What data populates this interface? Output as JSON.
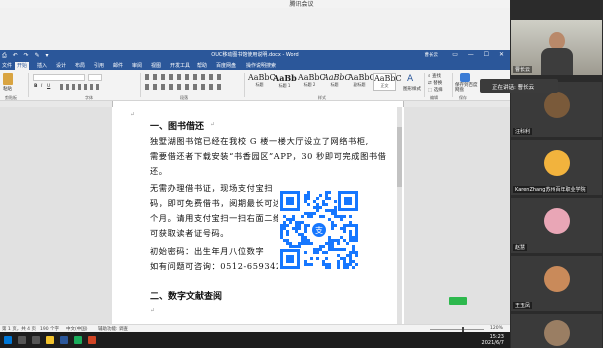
{
  "meeting": {
    "window_title": "腾讯会议",
    "speaking_label": "正在讲话: 曹长云"
  },
  "word": {
    "doc_title": "OUC移动图书馆使用说明.docx - Word",
    "user": "曹长云",
    "qat": "⎙ ↶ ↷ ✎ ▾",
    "window_controls": "▭ — ☐ ✕",
    "tabs": [
      "文件",
      "开始",
      "插入",
      "设计",
      "布局",
      "引用",
      "邮件",
      "审阅",
      "视图",
      "开发工具",
      "帮助",
      "百度网盘",
      "操作说明搜索"
    ],
    "active_tab": "开始",
    "ribbon": {
      "paste": "粘贴",
      "clipboard_label": "剪贴板",
      "font_label": "字体",
      "paragraph_label": "段落",
      "styles_label": "样式",
      "edit_label": "编辑",
      "save_label": "保存",
      "find": "查找",
      "replace": "替换",
      "select": "选择",
      "text_style_btn": "图形样式",
      "save_to_baidu": "保存到百度网盘",
      "styles": [
        {
          "sample": "AaBbC",
          "name": "标题"
        },
        {
          "sample": "AaBb",
          "name": "标题 1"
        },
        {
          "sample": "AaBbC",
          "name": "标题 2"
        },
        {
          "sample": "AaBbC",
          "name": "标题"
        },
        {
          "sample": "AaBbC",
          "name": "副标题"
        },
        {
          "sample": "AaBbC",
          "name": "正文"
        }
      ]
    },
    "document": {
      "heading1": "一、图书借还",
      "para1_line1": "独墅湖图书馆已经在我校 G 楼一楼大厅设立了网络书柜,",
      "para1_line2": "需要借还者下载安装“书香园区”APP，30 秒即可完成图书借",
      "para1_line3": "还。",
      "para2_line1": "无需办理借书证，现场支付宝扫",
      "para2_line2": "码，即可免费借书，阅期最长可达两",
      "para2_line3": "个月。请用支付宝扫一扫右面二维码",
      "para2_line4": "可获取读者证号码。",
      "para3_line1": "初始密码：出生年月八位数字",
      "para3_line2": "如有问题可咨询：0512-65934206",
      "heading2": "二、数字文献查阅",
      "para_mark": "↵"
    },
    "status": {
      "page": "第 1 页，共 4 页",
      "words": "190 个字",
      "lang": "中文(中国)",
      "accessibility": "辅助功能: 调查",
      "zoom": "120%",
      "zoom_level_percent": 60
    }
  },
  "taskbar": {
    "time": "15:23",
    "date": "2021/6/7"
  },
  "participants": [
    {
      "name": "曹长云",
      "kind": "video"
    },
    {
      "name": "汪科利",
      "kind": "avatar",
      "color": "#7a5a3a"
    },
    {
      "name": "KarenZhang苏州百年职业学院",
      "kind": "avatar",
      "color": "#f2b33d"
    },
    {
      "name": "赵慧",
      "kind": "avatar",
      "color": "#e9a6b6"
    },
    {
      "name": "王玉凤",
      "kind": "avatar",
      "color": "#c98a5a"
    },
    {
      "name": "",
      "kind": "avatar",
      "color": "#9a7e63"
    }
  ]
}
